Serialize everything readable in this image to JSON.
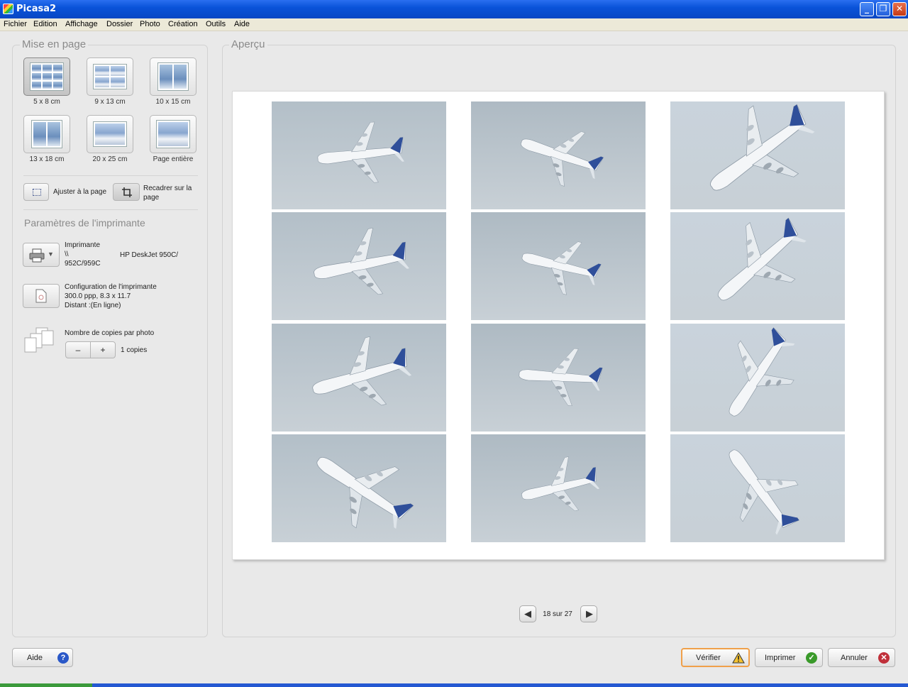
{
  "window": {
    "title": "Picasa2"
  },
  "menu": [
    "Fichier",
    "Edition",
    "Affichage",
    "Dossier",
    "Photo",
    "Création",
    "Outils",
    "Aide"
  ],
  "layout_panel": {
    "title": "Mise en page",
    "tiles": [
      {
        "label": "5 x 8 cm",
        "selected": true
      },
      {
        "label": "9 x 13 cm",
        "selected": false
      },
      {
        "label": "10 x 15 cm",
        "selected": false
      },
      {
        "label": "13 x 18 cm",
        "selected": false
      },
      {
        "label": "20 x 25 cm",
        "selected": false
      },
      {
        "label": "Page entière",
        "selected": false
      }
    ],
    "fit_label": "Ajuster à la page",
    "crop_label": "Recadrer sur la page"
  },
  "printer": {
    "section_title": "Paramètres de l'imprimante",
    "printer_label": "Imprimante",
    "printer_path_1": "\\\\",
    "printer_path_2": "952C/959C",
    "printer_name": "HP DeskJet 950C/",
    "config_title": "Configuration de l'imprimante",
    "config_line1": "300.0 ppp, 8.3 x 11.7",
    "config_line2": "Distant :(En ligne)",
    "copies_title": "Nombre de copies par photo",
    "copies_minus": "–",
    "copies_plus": "+",
    "copies_value": "1 copies"
  },
  "preview": {
    "title": "Aperçu",
    "page_indicator": "18 sur 27",
    "photo_count": 12
  },
  "buttons": {
    "help": "Aide",
    "verify": "Vérifier",
    "print": "Imprimer",
    "cancel": "Annuler"
  },
  "colors": {
    "titlebar": "#0a53d9",
    "verify_border": "#f0a04a",
    "print_check": "#3a9a2a",
    "cancel_x": "#c0303a",
    "help_icon": "#2a58c8"
  }
}
